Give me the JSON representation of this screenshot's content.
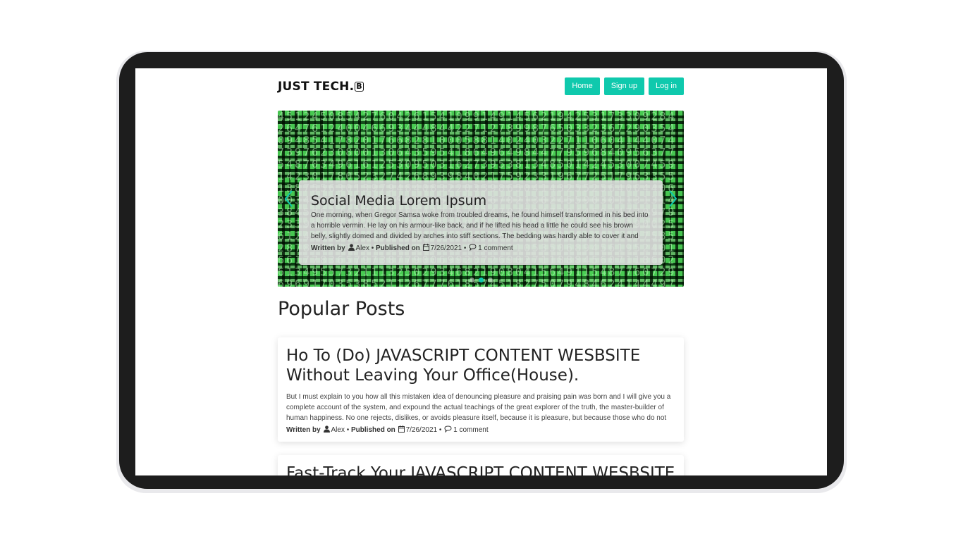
{
  "header": {
    "logo": "JUST TECH.",
    "logo_mark": "B",
    "nav": [
      "Home",
      "Sign up",
      "Log in"
    ]
  },
  "hero": {
    "title": "Social Media Lorem Ipsum",
    "text": "One morning, when Gregor Samsa woke from troubled dreams, he found himself transformed in his bed into a horrible vermin. He lay on his armour-like back, and if he lifted his head a little he could see his brown belly, slightly domed and divided by arches into stiff sections. The bedding was hardly able to cover it and seemed...",
    "meta": {
      "written_by": "Written by",
      "author": "Alex",
      "published_on": "Published on",
      "date": "7/26/2021",
      "comments": "1 comment"
    },
    "slides": 3,
    "active_slide": 2
  },
  "popular": {
    "title": "Popular Posts",
    "posts": [
      {
        "title": "Ho To (Do) JAVASCRIPT CONTENT WESBSITE Without Leaving Your Office(House).",
        "text": "But I must explain to you how all this mistaken idea of denouncing pleasure and praising pain was born and I will give you a complete account of the system, and expound the actual teachings of the great explorer of the truth, the master-builder of human happiness. No one rejects, dislikes, or avoids pleasure itself, because it is pleasure, but because those who do not kno...",
        "meta": {
          "written_by": "Written by",
          "author": "Alex",
          "published_on": "Published on",
          "date": "7/26/2021",
          "comments": "1 comment"
        }
      },
      {
        "title": "Fast-Track Your JAVASCRIPT CONTENT WESBSITE"
      }
    ]
  },
  "colors": {
    "accent": "#0fc9ad",
    "device_frame": "#1d1d1d"
  },
  "icons": [
    "user-icon",
    "calendar-icon",
    "comment-icon",
    "chevron-left-icon",
    "chevron-right-icon"
  ]
}
